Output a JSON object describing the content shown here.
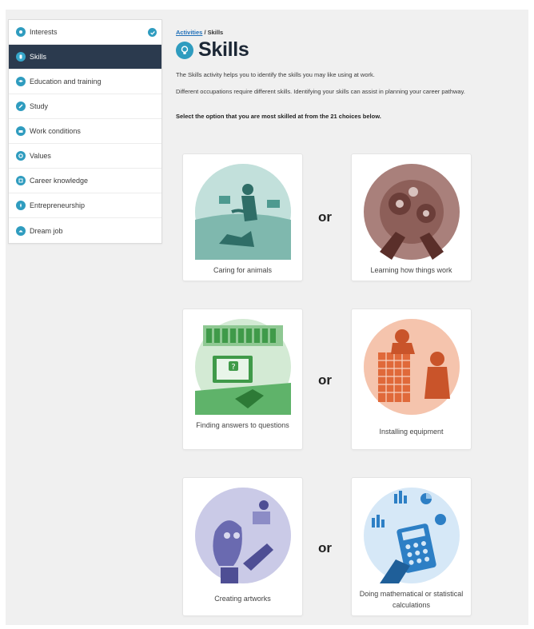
{
  "sidebar": {
    "items": [
      {
        "label": "Interests",
        "icon": "interests-icon",
        "completed": true
      },
      {
        "label": "Skills",
        "icon": "skills-icon",
        "active": true
      },
      {
        "label": "Education and training",
        "icon": "education-icon"
      },
      {
        "label": "Study",
        "icon": "study-icon"
      },
      {
        "label": "Work conditions",
        "icon": "work-conditions-icon"
      },
      {
        "label": "Values",
        "icon": "values-icon"
      },
      {
        "label": "Career knowledge",
        "icon": "career-knowledge-icon"
      },
      {
        "label": "Entrepreneurship",
        "icon": "entrepreneurship-icon"
      },
      {
        "label": "Dream job",
        "icon": "dream-job-icon"
      }
    ]
  },
  "breadcrumb": {
    "link": "Activities",
    "separator": " / ",
    "current": "Skills"
  },
  "page": {
    "title": "Skills",
    "description_1": "The Skills activity helps you to identify the skills you may like using at work.",
    "description_2": "Different occupations require different skills. Identifying your skills can assist in planning your career pathway.",
    "prompt": "Select the option that you are most skilled at from the 21 choices below."
  },
  "choices": [
    {
      "left": "Caring for animals",
      "right": "Learning how things work",
      "separator": "or"
    },
    {
      "left": "Finding answers to questions",
      "right": "Installing equipment",
      "separator": "or"
    },
    {
      "left": "Creating artworks",
      "right": "Doing mathematical or statistical calculations",
      "separator": "or"
    }
  ],
  "colors": {
    "accent": "#2f9cbf",
    "active_nav": "#2b3a4e",
    "link": "#1f6fb8",
    "animals": "#3f8f86",
    "mechanics": "#7a4a45",
    "answers": "#3f9a49",
    "install": "#e0693a",
    "art": "#6a6ab0",
    "math": "#2d7fc5"
  }
}
